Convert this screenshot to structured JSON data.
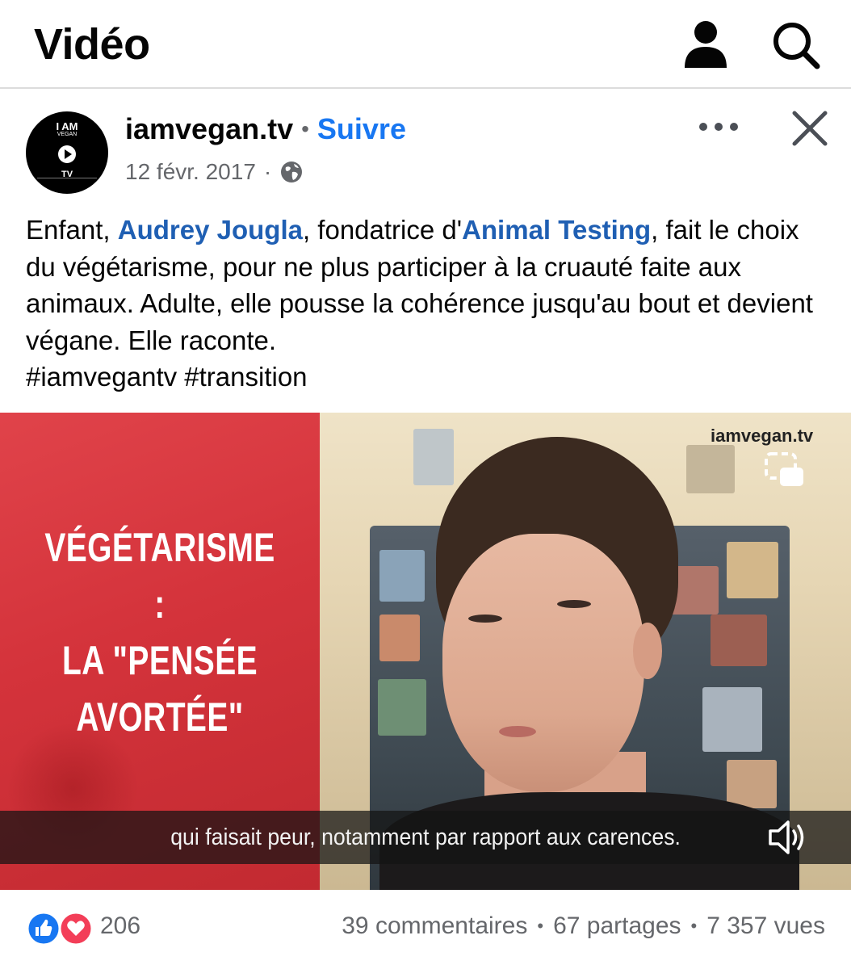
{
  "header": {
    "title": "Vidéo",
    "profile_icon": "profile-icon",
    "search_icon": "search-icon"
  },
  "post": {
    "avatar": {
      "line1": "I AM",
      "line2": "VEGAN",
      "line3": "TV"
    },
    "author": "iamvegan.tv",
    "separator": "•",
    "follow_label": "Suivre",
    "date": "12 févr. 2017",
    "date_separator": "·",
    "privacy_icon": "globe-icon",
    "text": {
      "part1": "Enfant, ",
      "mention1": "Audrey Jougla",
      "part2": ", fondatrice d'",
      "mention2": "Animal Testing",
      "part3": ", fait le choix du végétarisme, pour ne plus participer à la cruauté faite aux animaux. Adulte, elle pousse la cohérence jusqu'au bout et devient végane. Elle raconte.",
      "hashtags": "#iamvegantv #transition"
    }
  },
  "video": {
    "overlay_line1": "VÉGÉTARISME :",
    "overlay_line2": "LA \"PENSÉE",
    "overlay_line3": "AVORTÉE\"",
    "watermark": "iamvegan.tv",
    "subtitle": "qui faisait peur, notamment par rapport aux carences.",
    "pip_icon": "picture-in-picture-icon",
    "volume_icon": "volume-icon"
  },
  "footer": {
    "reaction_count": "206",
    "comments": "39 commentaires",
    "shares": "67 partages",
    "views": "7 357 vues",
    "bullet": "•"
  },
  "colors": {
    "link_blue": "#1877f2",
    "mention_blue": "#1f5fb3",
    "like_blue": "#1877f2",
    "love_red": "#f33e58",
    "video_red": "#d4333b"
  }
}
